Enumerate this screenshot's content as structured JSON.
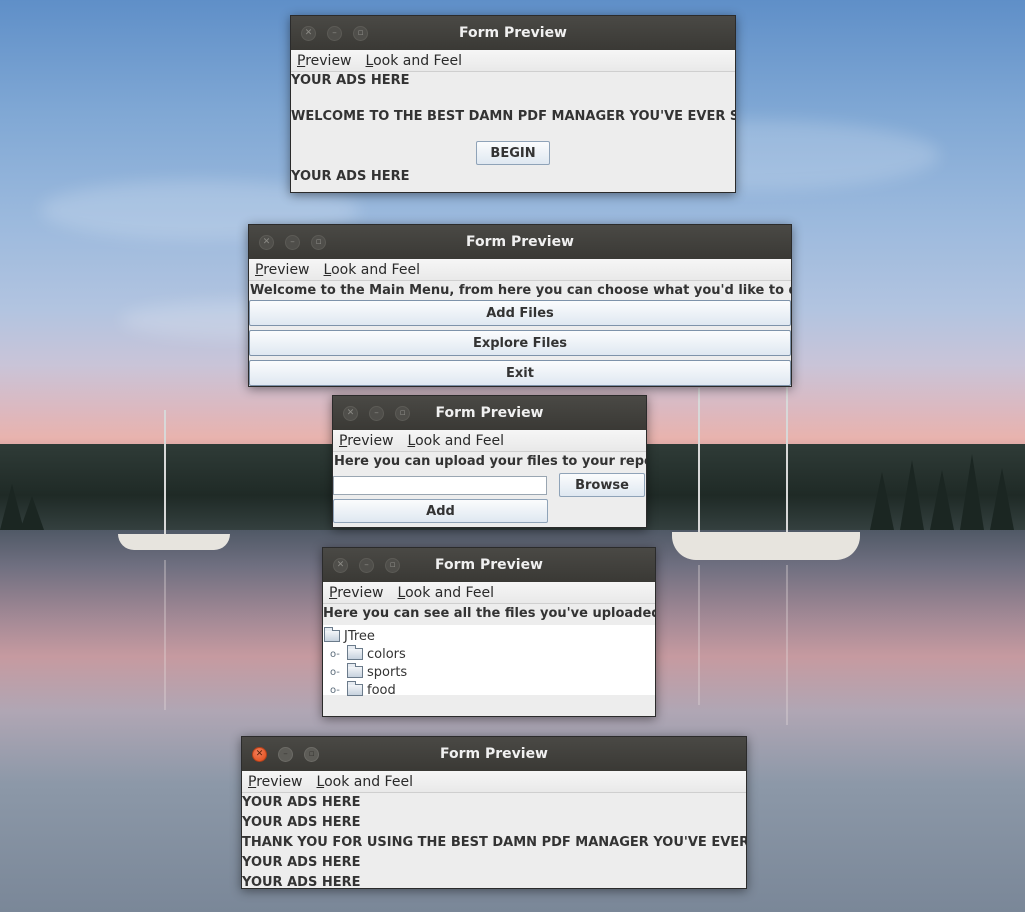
{
  "windows": {
    "welcome": {
      "title": "Form Preview",
      "menu": [
        "Preview",
        "Look and Feel"
      ],
      "ads_top": "YOUR ADS HERE",
      "welcome_text": "WELCOME TO THE BEST DAMN PDF MANAGER YOU'VE EVER SEEN!",
      "begin_label": "BEGIN",
      "ads_bottom": "YOUR ADS HERE"
    },
    "main_menu": {
      "title": "Form Preview",
      "menu": [
        "Preview",
        "Look and Feel"
      ],
      "intro": "Welcome to the Main Menu, from here you can choose what you'd like to do.",
      "add_files_label": "Add Files",
      "explore_files_label": "Explore Files",
      "exit_label": "Exit"
    },
    "upload": {
      "title": "Form Preview",
      "menu": [
        "Preview",
        "Look and Feel"
      ],
      "intro": "Here you can upload your files to your repo.",
      "file_field_value": "",
      "browse_label": "Browse",
      "add_label": "Add"
    },
    "explore": {
      "title": "Form Preview",
      "menu": [
        "Preview",
        "Look and Feel"
      ],
      "intro": "Here you can see all the files you've uploaded!",
      "tree_root": "JTree",
      "tree_children": [
        "colors",
        "sports",
        "food"
      ]
    },
    "goodbye": {
      "title": "Form Preview",
      "menu": [
        "Preview",
        "Look and Feel"
      ],
      "lines": [
        "YOUR ADS HERE",
        "YOUR ADS HERE",
        "THANK YOU FOR USING THE BEST DAMN PDF MANAGER YOU'VE EVER SEEN",
        "YOUR ADS HERE",
        "YOUR ADS HERE"
      ]
    }
  },
  "icons": {
    "close": "close-icon",
    "minimize": "minimize-icon",
    "maximize": "maximize-icon",
    "folder": "folder-icon",
    "expand": "expand-handle-icon"
  },
  "colors": {
    "titlebar": "#3f3e3a",
    "close_active": "#e2541f",
    "window_bg": "#ededed",
    "button_border": "#8fa3b8"
  }
}
